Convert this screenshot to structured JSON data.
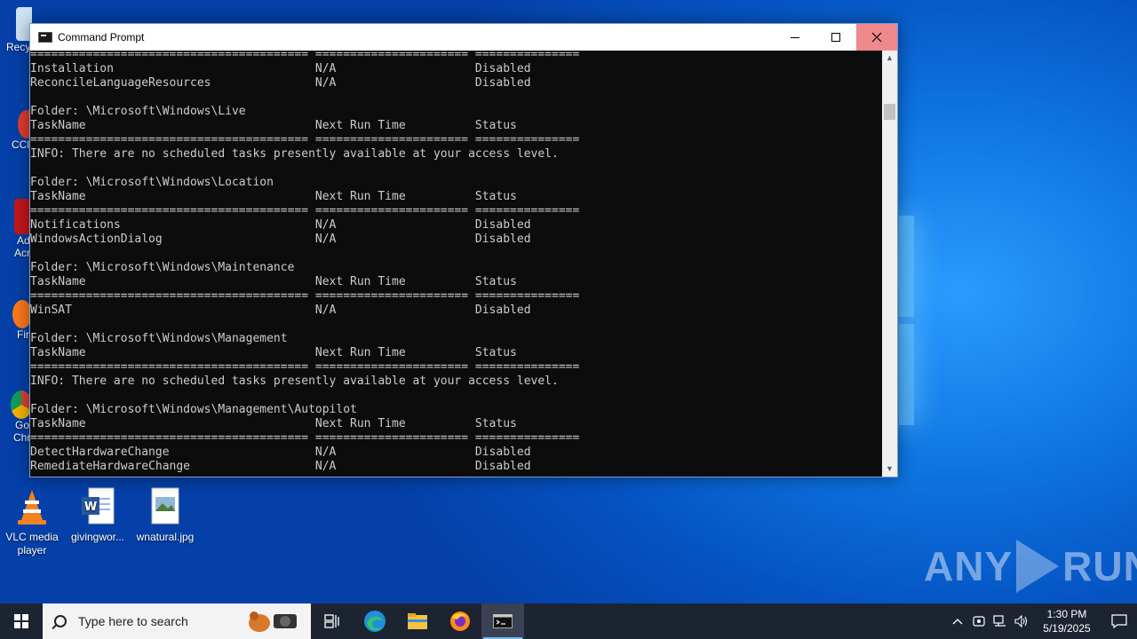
{
  "window": {
    "title": "Command Prompt",
    "console_lines": [
      "======================================== ====================== ===============",
      "Installation                             N/A                    Disabled",
      "ReconcileLanguageResources               N/A                    Disabled",
      "",
      "Folder: \\Microsoft\\Windows\\Live",
      "TaskName                                 Next Run Time          Status",
      "======================================== ====================== ===============",
      "INFO: There are no scheduled tasks presently available at your access level.",
      "",
      "Folder: \\Microsoft\\Windows\\Location",
      "TaskName                                 Next Run Time          Status",
      "======================================== ====================== ===============",
      "Notifications                            N/A                    Disabled",
      "WindowsActionDialog                      N/A                    Disabled",
      "",
      "Folder: \\Microsoft\\Windows\\Maintenance",
      "TaskName                                 Next Run Time          Status",
      "======================================== ====================== ===============",
      "WinSAT                                   N/A                    Disabled",
      "",
      "Folder: \\Microsoft\\Windows\\Management",
      "TaskName                                 Next Run Time          Status",
      "======================================== ====================== ===============",
      "INFO: There are no scheduled tasks presently available at your access level.",
      "",
      "Folder: \\Microsoft\\Windows\\Management\\Autopilot",
      "TaskName                                 Next Run Time          Status",
      "======================================== ====================== ===============",
      "DetectHardwareChange                     N/A                    Disabled",
      "RemediateHardwareChange                  N/A                    Disabled"
    ]
  },
  "desktop": {
    "left_labels": [
      "Recy",
      "CCl",
      "Ad",
      "Acr",
      "Fir",
      "Go",
      "Chr"
    ],
    "icons": [
      {
        "name": "VLC media player",
        "icon": "vlc-cone-icon"
      },
      {
        "name": "givingwor...",
        "icon": "word-document-icon"
      },
      {
        "name": "wnatural.jpg",
        "icon": "image-file-icon"
      }
    ],
    "watermark_left": "ANY",
    "watermark_right": "RUN"
  },
  "taskbar": {
    "search_placeholder": "Type here to search",
    "apps": [
      "task-view-icon",
      "edge-icon",
      "file-explorer-icon",
      "firefox-icon",
      "command-prompt-icon"
    ],
    "clock_time": "1:30 PM",
    "clock_date": "5/19/2025"
  },
  "colors": {
    "console_bg": "#0c0c0c",
    "console_fg": "#cccccc",
    "taskbar_bg": "#1c2331",
    "close_hover": "#f0898c"
  }
}
